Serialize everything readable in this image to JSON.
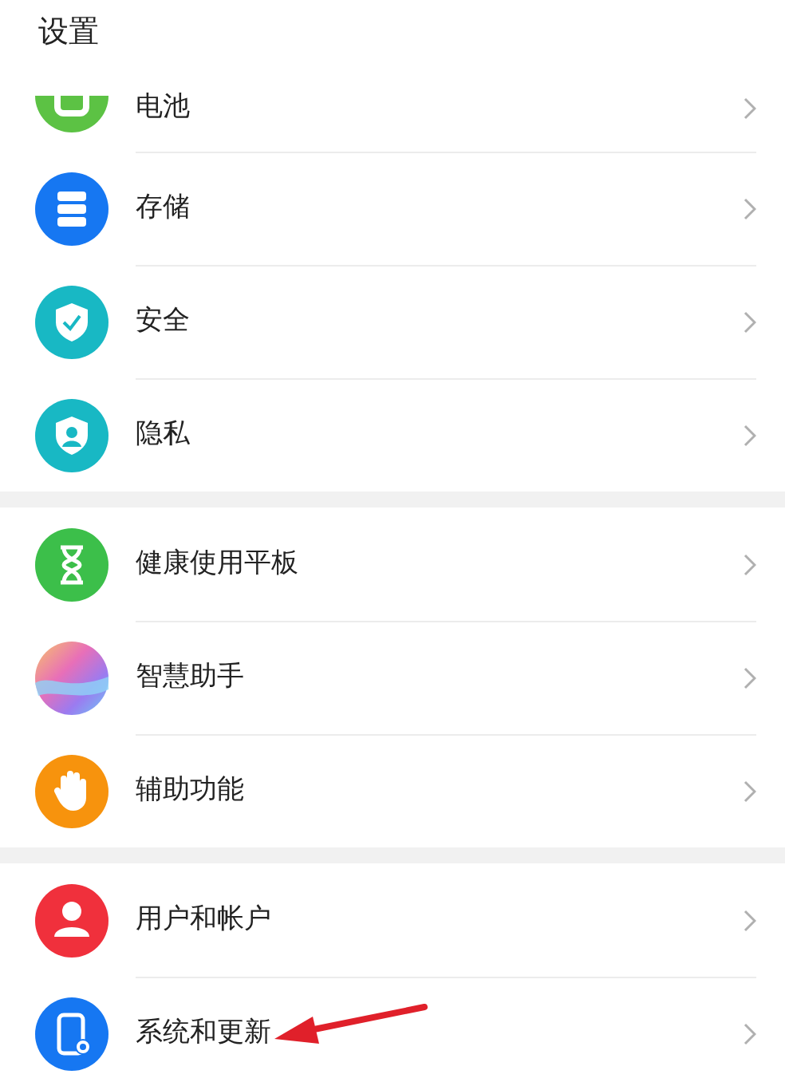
{
  "title": "设置",
  "groups": [
    {
      "items": [
        {
          "label": "电池",
          "kind": "battery",
          "color": "#5cc244",
          "partial": true
        },
        {
          "label": "存储",
          "kind": "storage",
          "color": "#1677f2"
        },
        {
          "label": "安全",
          "kind": "security",
          "color": "#18b8c4"
        },
        {
          "label": "隐私",
          "kind": "privacy",
          "color": "#18b8c4"
        }
      ]
    },
    {
      "items": [
        {
          "label": "健康使用平板",
          "kind": "hourglass",
          "color": "#3cbf4a"
        },
        {
          "label": "智慧助手",
          "kind": "assistant"
        },
        {
          "label": "辅助功能",
          "kind": "hand",
          "color": "#f7930d"
        }
      ]
    },
    {
      "items": [
        {
          "label": "用户和帐户",
          "kind": "user",
          "color": "#f0303c"
        },
        {
          "label": "系统和更新",
          "kind": "phone",
          "color": "#1677f2",
          "annotated": true
        }
      ]
    }
  ]
}
